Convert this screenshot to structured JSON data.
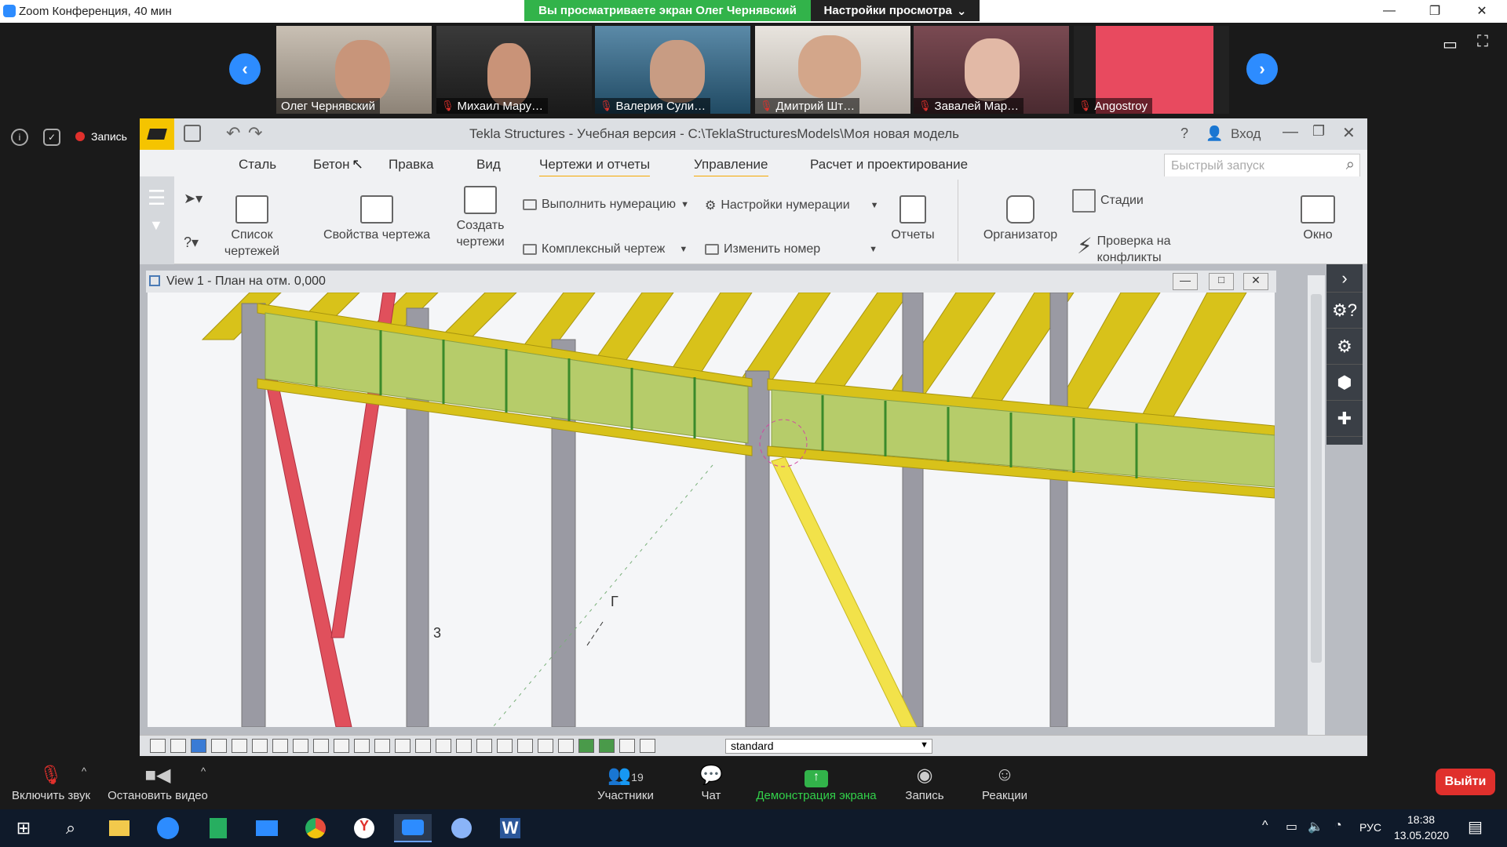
{
  "zoom": {
    "window_title": "Zoom Конференция, 40 мин",
    "share_banner": "Вы просматриваете экран Олег Чернявский",
    "view_options": "Настройки просмотра",
    "recording_label": "Запись",
    "participants": [
      {
        "name": "Олег Чернявский",
        "muted": false
      },
      {
        "name": "Михаил Мару…",
        "muted": true
      },
      {
        "name": "Валерия Сули…",
        "muted": true
      },
      {
        "name": "Дмитрий Шт…",
        "muted": true
      },
      {
        "name": "Завалей Мар…",
        "muted": true
      },
      {
        "name": "Angostroy",
        "muted": true
      }
    ],
    "toolbar": {
      "unmute": "Включить звук",
      "stop_video": "Остановить видео",
      "participants": "Участники",
      "participants_count": "19",
      "chat": "Чат",
      "share_screen": "Демонстрация экрана",
      "record": "Запись",
      "reactions": "Реакции",
      "leave": "Выйти"
    }
  },
  "tekla": {
    "title": "Tekla Structures - Учебная версия - C:\\TeklaStructuresModels\\Моя новая модель",
    "login": "Вход",
    "tabs": [
      "Сталь",
      "Бетон",
      "Правка",
      "Вид",
      "Чертежи и отчеты",
      "Управление",
      "Расчет и проектирование"
    ],
    "active_tab": "Чертежи и отчеты",
    "quick_search_placeholder": "Быстрый запуск",
    "ribbon": {
      "drawing_list": "Список чертежей",
      "drawing_props": "Свойства чертежа",
      "create_drawings": "Создать чертежи",
      "run_numbering": "Выполнить нумерацию",
      "numbering_settings": "Настройки нумерации",
      "complex_drawing": "Комплексный чертеж",
      "change_number": "Изменить номер",
      "reports": "Отчеты",
      "organizer": "Организатор",
      "stages": "Стадии",
      "clash_check": "Проверка на конфликты",
      "window": "Окно"
    },
    "view_title": "View 1 - План на отм. 0,000",
    "bottom_select": "standard",
    "viewport_labels": [
      "3",
      "Г"
    ],
    "colors": {
      "beam_yellow": "#d8c21a",
      "panel_green": "#b6cc6a",
      "column_grey": "#9a9aa3",
      "brace_red": "#e0505c"
    }
  },
  "taskbar": {
    "time": "18:38",
    "date": "13.05.2020",
    "lang": "РУС"
  }
}
